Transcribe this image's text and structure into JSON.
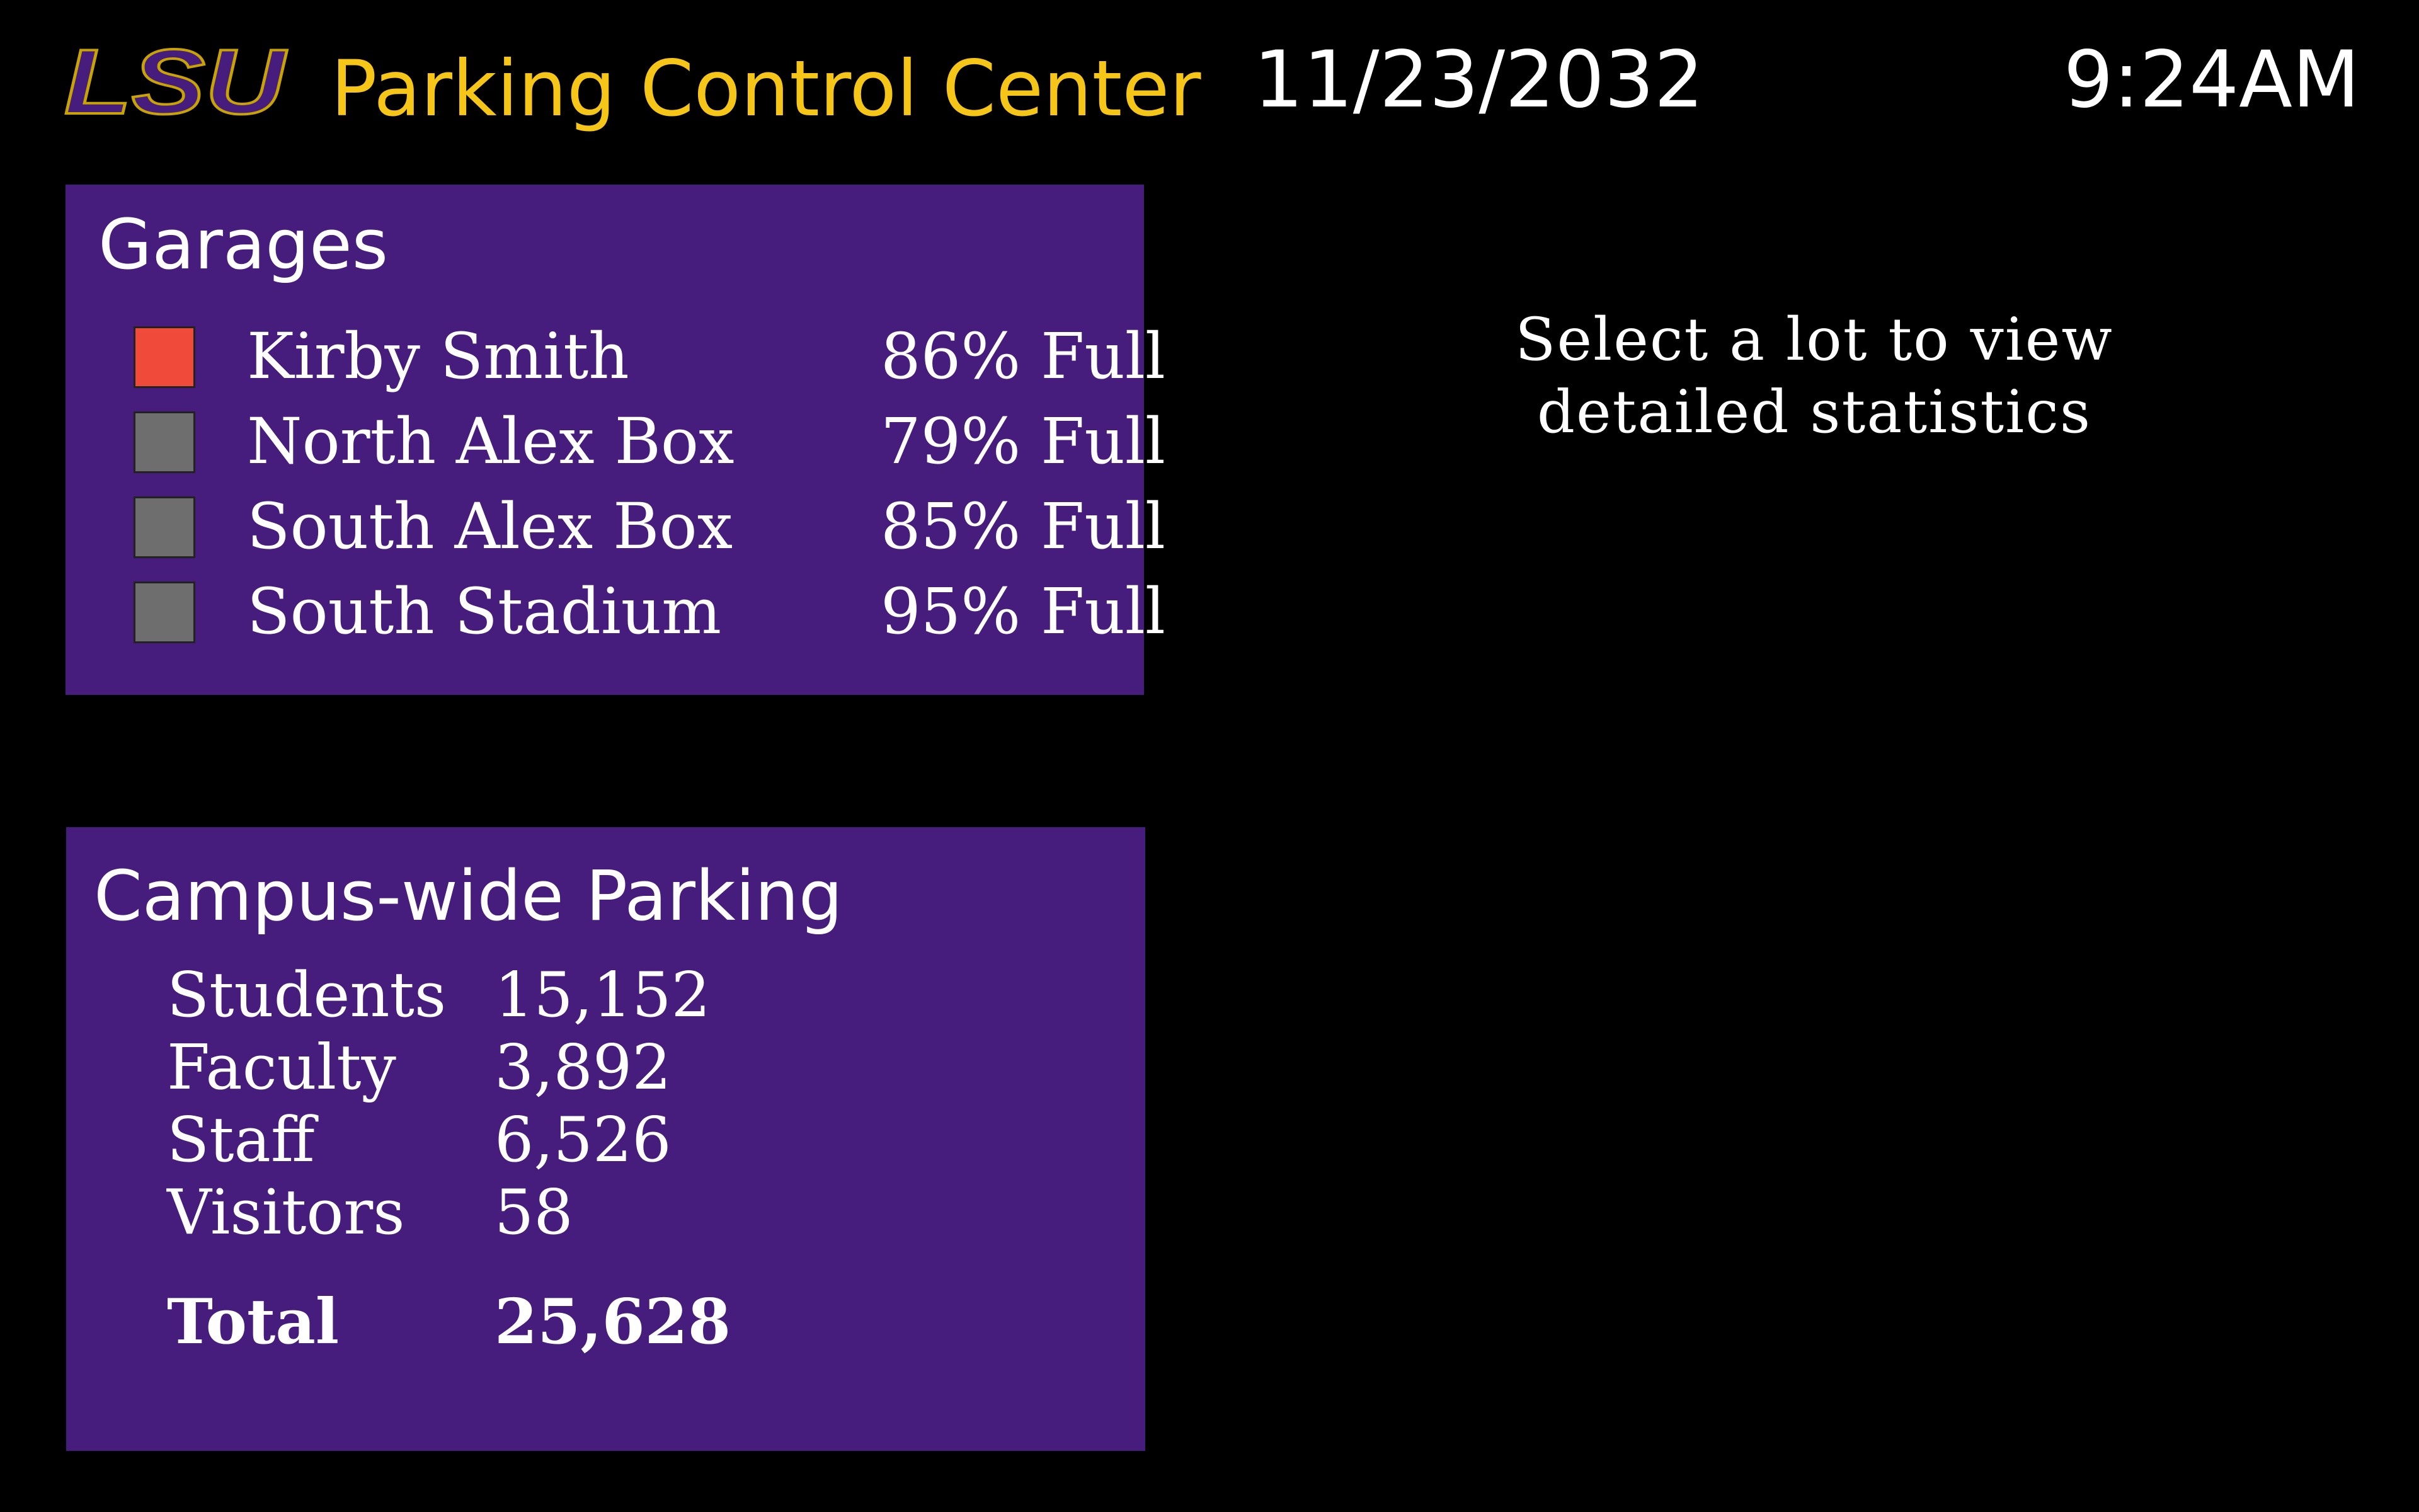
{
  "header": {
    "logo_text": "LSU",
    "title": "Parking Control Center",
    "date": "11/23/2032",
    "time": "9:24AM"
  },
  "colors": {
    "brand_purple": "#461d7c",
    "brand_gold": "#f5c518",
    "alert_red": "#f04a3a",
    "normal_gray": "#6e6e6e"
  },
  "garages": {
    "title": "Garages",
    "items": [
      {
        "name": "Kirby Smith",
        "status": "86% Full",
        "indicator": "red"
      },
      {
        "name": "North Alex Box",
        "status": "79% Full",
        "indicator": "gray"
      },
      {
        "name": "South Alex Box",
        "status": "85% Full",
        "indicator": "gray"
      },
      {
        "name": "South Stadium",
        "status": "95% Full",
        "indicator": "gray"
      }
    ]
  },
  "campus": {
    "title": "Campus-wide Parking",
    "rows": [
      {
        "label": "Students",
        "value": "15,152"
      },
      {
        "label": "Faculty",
        "value": "3,892"
      },
      {
        "label": "Staff",
        "value": "6,526"
      },
      {
        "label": "Visitors",
        "value": "58"
      }
    ],
    "total": {
      "label": "Total",
      "value": "25,628"
    }
  },
  "detail": {
    "hint_line1": "Select a lot to view",
    "hint_line2": "detailed statistics"
  }
}
